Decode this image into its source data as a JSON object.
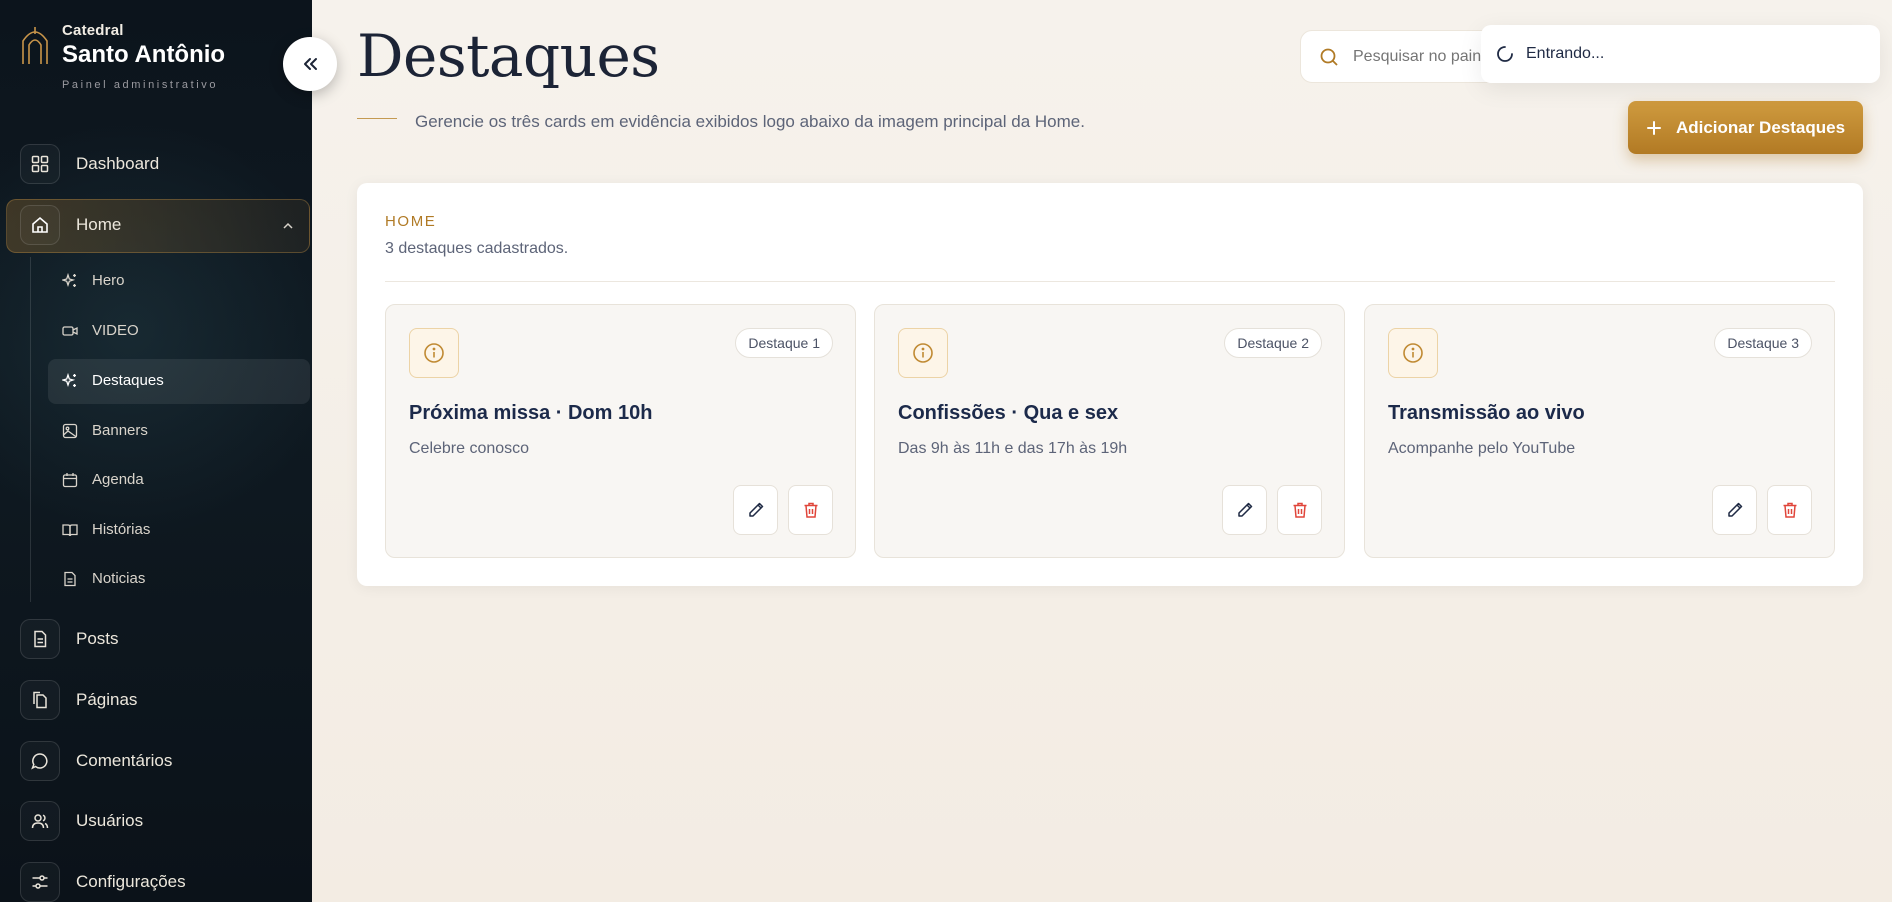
{
  "brand": {
    "small": "Catedral",
    "name": "Santo Antônio",
    "subtitle": "Painel administrativo"
  },
  "nav": {
    "dashboard": "Dashboard",
    "home": "Home",
    "home_sub": {
      "hero": "Hero",
      "video": "VIDEO",
      "destaques": "Destaques",
      "banners": "Banners",
      "agenda": "Agenda",
      "historias": "Histórias",
      "noticias": "Noticias"
    },
    "posts": "Posts",
    "paginas": "Páginas",
    "comentarios": "Comentários",
    "usuarios": "Usuários",
    "configuracoes": "Configurações"
  },
  "header": {
    "title": "Destaques",
    "description": "Gerencie os três cards em evidência exibidos logo abaixo da imagem principal da Home.",
    "search_placeholder": "Pesquisar no painel",
    "add_button": "Adicionar Destaques"
  },
  "toast": {
    "message": "Entrando..."
  },
  "panel": {
    "kicker": "HOME",
    "count": "3 destaques cadastrados.",
    "cards": [
      {
        "badge": "Destaque 1",
        "title": "Próxima missa · Dom 10h",
        "subtitle": "Celebre conosco"
      },
      {
        "badge": "Destaque 2",
        "title": "Confissões · Qua e sex",
        "subtitle": "Das 9h às 11h e das 17h às 19h"
      },
      {
        "badge": "Destaque 3",
        "title": "Transmissão ao vivo",
        "subtitle": "Acompanhe pelo YouTube"
      }
    ]
  },
  "colors": {
    "accent": "#c08a33",
    "sidebar_bg": "#0c141c",
    "danger": "#e0453a"
  },
  "icons": {
    "collapse": "chevrons-left-icon",
    "card": "info-icon",
    "edit": "pencil-icon",
    "delete": "trash-icon"
  }
}
